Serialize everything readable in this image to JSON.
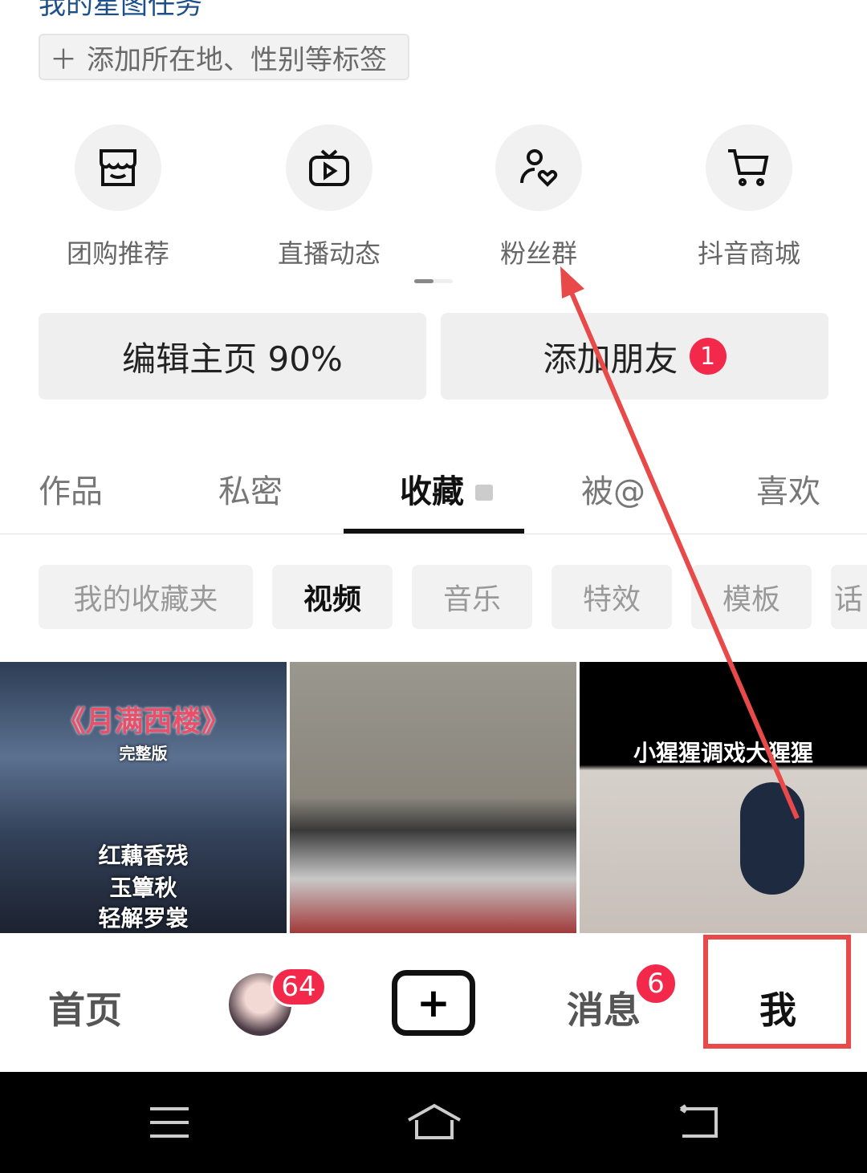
{
  "header": {
    "task_title": "我的星图任务",
    "add_tags": "添加所在地、性别等标签"
  },
  "shortcuts": [
    {
      "label": "团购推荐",
      "icon": "store-icon"
    },
    {
      "label": "直播动态",
      "icon": "tv-play-icon"
    },
    {
      "label": "粉丝群",
      "icon": "fan-group-icon"
    },
    {
      "label": "抖音商城",
      "icon": "cart-icon"
    }
  ],
  "actions": {
    "edit_profile": "编辑主页 90%",
    "add_friends": "添加朋友",
    "add_friends_badge": "1"
  },
  "tabs": [
    {
      "label": "作品"
    },
    {
      "label": "私密"
    },
    {
      "label": "收藏",
      "active": true,
      "locked": true
    },
    {
      "label": "被@"
    },
    {
      "label": "喜欢"
    }
  ],
  "chips": [
    {
      "label": "我的收藏夹"
    },
    {
      "label": "视频",
      "active": true
    },
    {
      "label": "音乐"
    },
    {
      "label": "特效"
    },
    {
      "label": "模板"
    },
    {
      "label": "话"
    }
  ],
  "videos": [
    {
      "title": "《月满西楼》",
      "subtitle": "完整版",
      "lines": [
        "红藕香残",
        "玉簟秋",
        "轻解罗裳"
      ]
    },
    {
      "title": ""
    },
    {
      "title": "小猩猩调戏大猩猩"
    }
  ],
  "nav": {
    "home": "首页",
    "friends_badge": "64",
    "messages": "消息",
    "messages_badge": "6",
    "me": "我"
  },
  "annotation_color": "#e84a4a"
}
